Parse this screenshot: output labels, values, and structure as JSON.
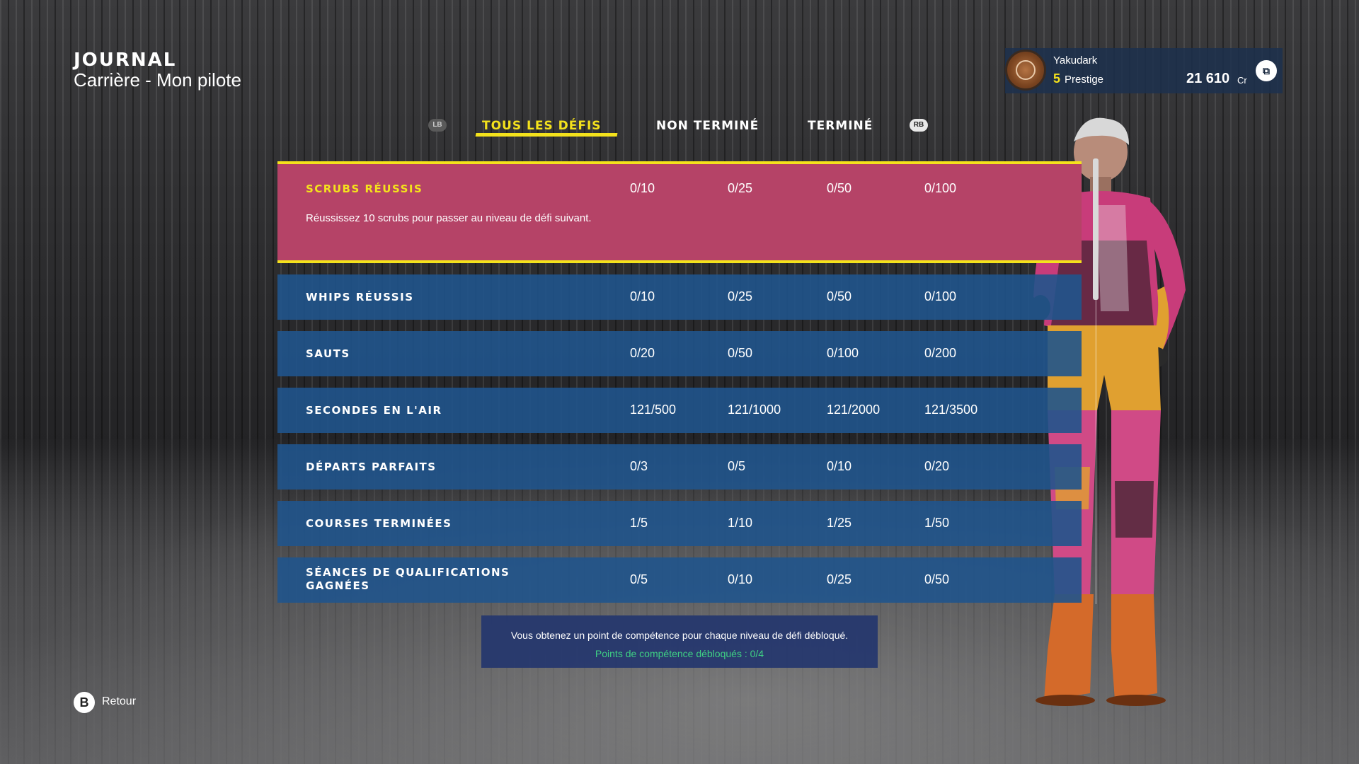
{
  "header": {
    "title": "JOURNAL",
    "subtitle": "Carrière  - Mon pilote"
  },
  "profile": {
    "username": "Yakudark",
    "prestige_level": "5",
    "prestige_label": "Prestige",
    "credits": "21 610",
    "credits_unit": "Cr",
    "avatar_icon": "laurel-badge-icon",
    "friends_icon": "friends-icon"
  },
  "tabs": {
    "lb": "LB",
    "rb": "RB",
    "items": [
      {
        "label": "TOUS LES DÉFIS",
        "active": true
      },
      {
        "label": "NON TERMINÉ",
        "active": false
      },
      {
        "label": "TERMINÉ",
        "active": false
      }
    ]
  },
  "challenges": [
    {
      "name": "SCRUBS RÉUSSIS",
      "values": [
        "0/10",
        "0/25",
        "0/50",
        "0/100"
      ],
      "description": "Réussissez 10 scrubs pour passer au niveau de défi suivant.",
      "selected": true
    },
    {
      "name": "WHIPS RÉUSSIS",
      "values": [
        "0/10",
        "0/25",
        "0/50",
        "0/100"
      ]
    },
    {
      "name": "SAUTS",
      "values": [
        "0/20",
        "0/50",
        "0/100",
        "0/200"
      ]
    },
    {
      "name": "SECONDES EN L'AIR",
      "values": [
        "121/500",
        "121/1000",
        "121/2000",
        "121/3500"
      ]
    },
    {
      "name": "DÉPARTS PARFAITS",
      "values": [
        "0/3",
        "0/5",
        "0/10",
        "0/20"
      ]
    },
    {
      "name": "COURSES TERMINÉES",
      "values": [
        "1/5",
        "1/10",
        "1/25",
        "1/50"
      ]
    },
    {
      "name_line1": "SÉANCES DE QUALIFICATIONS",
      "name_line2": "GAGNÉES",
      "values": [
        "0/5",
        "0/10",
        "0/25",
        "0/50"
      ]
    }
  ],
  "info": {
    "line1": "Vous obtenez un point de compétence pour chaque niveau de défi débloqué.",
    "line2": "Points de compétence débloqués : 0/4"
  },
  "footer": {
    "back_key": "B",
    "back_label": "Retour"
  },
  "colors": {
    "accent": "#f4e21c",
    "selected_row": "#b54367",
    "row": "#20548c",
    "green": "#3fd184"
  }
}
